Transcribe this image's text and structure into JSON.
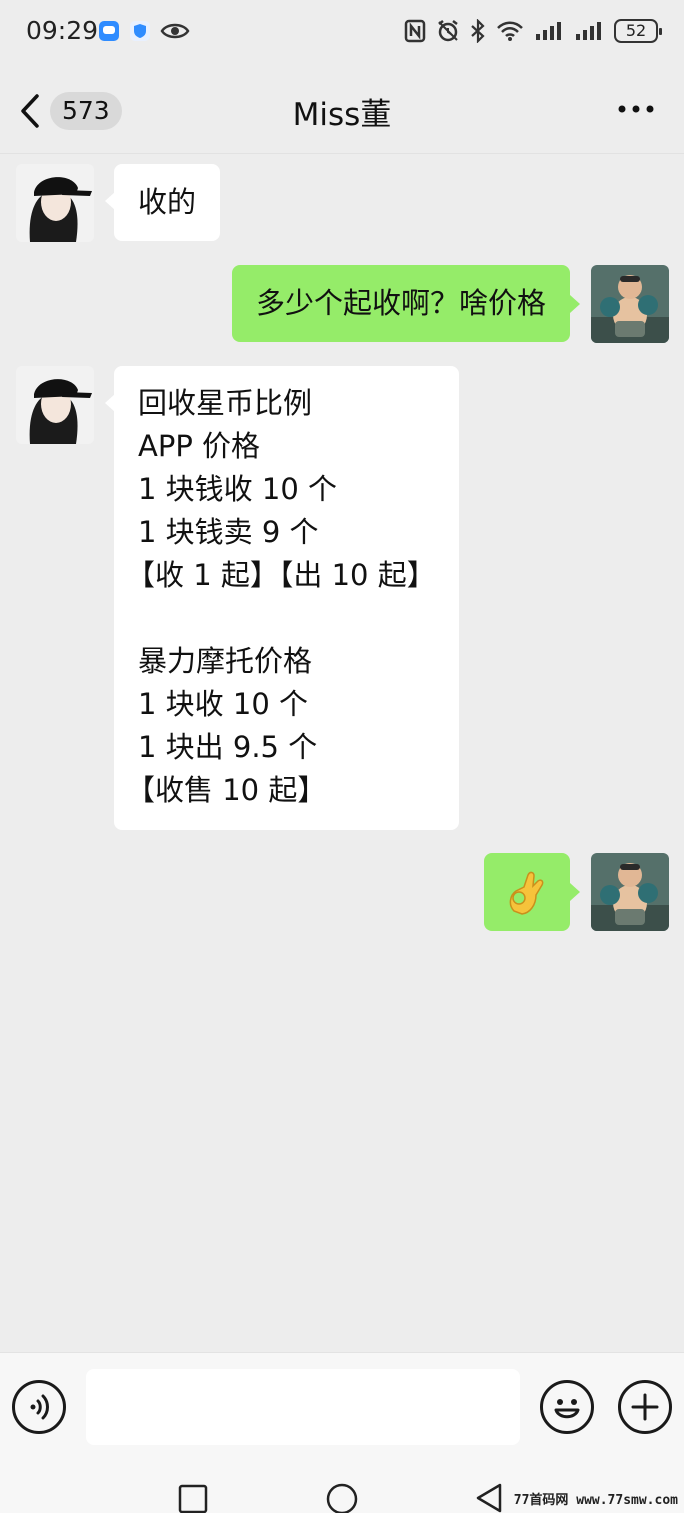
{
  "status_bar": {
    "time": "09:29",
    "battery": "52",
    "left_icons": [
      "message-app-icon",
      "shield-app-icon",
      "eye-icon"
    ],
    "right_icons": [
      "nfc-icon",
      "alarm-icon",
      "bluetooth-icon",
      "wifi-icon",
      "signal-icon",
      "signal-icon"
    ]
  },
  "nav": {
    "unread_count": "573",
    "title": "Miss董"
  },
  "messages": [
    {
      "side": "in",
      "lines": [
        "收的"
      ]
    },
    {
      "side": "out",
      "lines": [
        "多少个起收啊？啥价格"
      ]
    },
    {
      "side": "in",
      "lines": [
        "回收星币比例",
        "APP 价格",
        "1 块钱收 10 个",
        "1 块钱卖 9 个",
        "【收 1 起】【出 10 起】",
        "",
        "暴力摩托价格",
        "1 块收 10 个",
        "1 块出 9.5 个",
        "【收售 10 起】"
      ]
    },
    {
      "side": "out",
      "emoji": "👌"
    }
  ],
  "input": {
    "value": "",
    "placeholder": ""
  },
  "watermark": "77首码网 www.77smw.com",
  "colors": {
    "background": "#ededed",
    "out_bubble": "#95ec69",
    "in_bubble": "#ffffff"
  }
}
